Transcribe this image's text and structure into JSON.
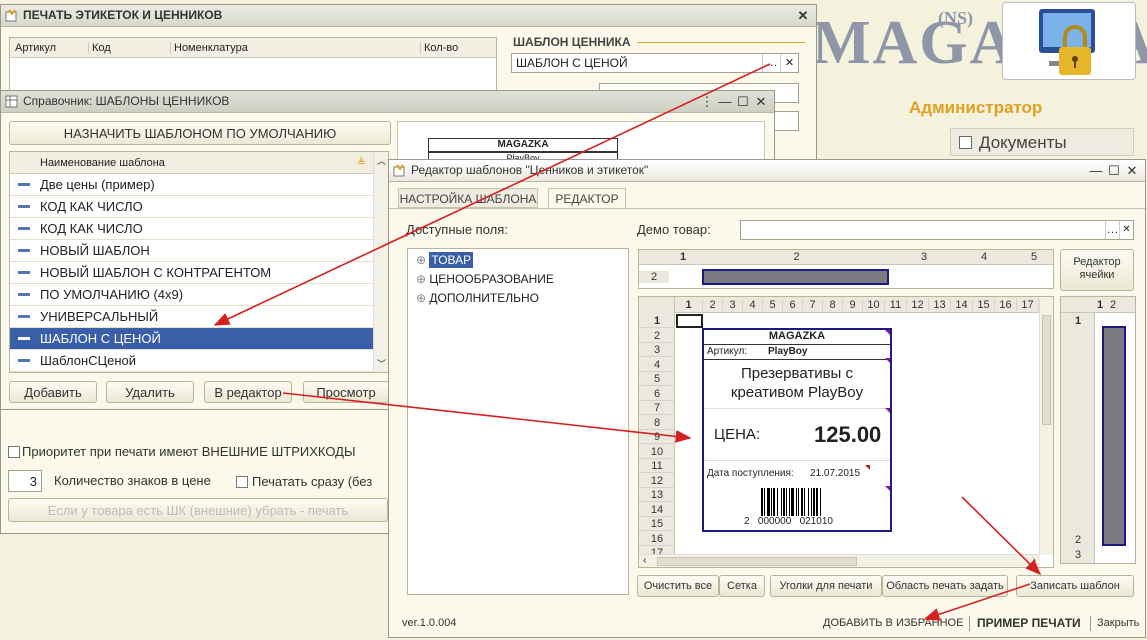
{
  "background": {
    "brand_logo": "MAGAZKA",
    "brand_suffix": "(NS)",
    "user_role": "Администратор",
    "nav_documents": "Документы"
  },
  "print_window": {
    "title": "ПЕЧАТЬ ЭТИКЕТОК И ЦЕННИКОВ",
    "columns": [
      "Артикул",
      "Код",
      "Номенклатура",
      "Кол-во"
    ],
    "template_group_label": "ШАБЛОН ЦЕННИКА",
    "template_value": "ШАБЛОН С ЦЕНОЙ",
    "priority_checkbox_label": "Приоритет при печати имеют ВНЕШНИЕ ШТРИХКОДЫ",
    "digits_value": "3",
    "digits_label": "Количество знаков в цене",
    "print_now_label": "Печатать сразу (без",
    "remove_barcode_button": "Если у товара есть ШК (внешние) убрать - печать"
  },
  "templates_window": {
    "title": "Справочник: ШАБЛОНЫ ЦЕННИКОВ",
    "default_button": "НАЗНАЧИТЬ ШАБЛОНОМ ПО УМОЛЧАНИЮ",
    "column_header": "Наименование шаблона",
    "items": [
      "Две цены (пример)",
      "КОД КАК ЧИСЛО",
      "КОД КАК ЧИСЛО",
      "НОВЫЙ ШАБЛОН",
      "НОВЫЙ ШАБЛОН С КОНТРАГЕНТОМ",
      "ПО УМОЛЧАНИЮ (4x9)",
      "УНИВЕРСАЛЬНЫЙ",
      "ШАБЛОН С ЦЕНОЙ",
      "ШаблонСЦеной"
    ],
    "selected_index": 7,
    "add_button": "Добавить",
    "delete_button": "Удалить",
    "editor_button": "В редактор",
    "preview_button": "Просмотр",
    "preview_header": "MAGAZKA",
    "preview_sub": "PlayBoy"
  },
  "editor_window": {
    "title": "Редактор шаблонов \"Ценников и этикеток\"",
    "tab_settings": "НАСТРОЙКА ШАБЛОНА",
    "tab_editor": "РЕДАКТОР",
    "fields_label": "Доступные поля:",
    "tree": [
      "ТОВАР",
      "ЦЕНООБРАЗОВАНИЕ",
      "ДОПОЛНИТЕЛЬНО"
    ],
    "demo_label": "Демо товар:",
    "cell_editor_button": "Редактор ячейки",
    "top_grid_cols": [
      "1",
      "2",
      "3",
      "4",
      "5"
    ],
    "top_grid_row": "2",
    "main_grid_cols": [
      "1",
      "2",
      "3",
      "4",
      "5",
      "6",
      "7",
      "8",
      "9",
      "10",
      "11",
      "12",
      "13",
      "14",
      "15",
      "16",
      "17"
    ],
    "main_grid_rows": [
      "1",
      "2",
      "3",
      "4",
      "5",
      "6",
      "7",
      "8",
      "9",
      "10",
      "11",
      "12",
      "13",
      "14",
      "15",
      "16",
      "17"
    ],
    "side_grid_cols": [
      "1",
      "2"
    ],
    "side_grid_rows": [
      "1",
      "2",
      "3"
    ],
    "label": {
      "header": "MAGAZKA",
      "article_label": "Артикул:",
      "article_value": "PlayBoy",
      "product_name": "Презервативы с креативом PlayBoy",
      "price_label": "ЦЕНА:",
      "price_value": "125.00",
      "date_label": "Дата поступления:",
      "date_value": "21.07.2015",
      "barcode_digits": "2   000000   021010"
    },
    "clear_button": "Очистить все",
    "grid_button": "Сетка",
    "corners_button": "Уголки для печати",
    "print_area_button": "Область печать задать",
    "save_button": "Записать шаблон",
    "version": "ver.1.0.004",
    "favorites_link": "ДОБАВИТЬ В ИЗБРАННОЕ",
    "print_sample_link": "ПРИМЕР ПЕЧАТИ",
    "close_link": "Закрыть"
  },
  "colors": {
    "selection": "#3a5ea8",
    "arrow": "#d62020",
    "accent_orange": "#e0a020",
    "label_border": "#1a1a8a"
  }
}
